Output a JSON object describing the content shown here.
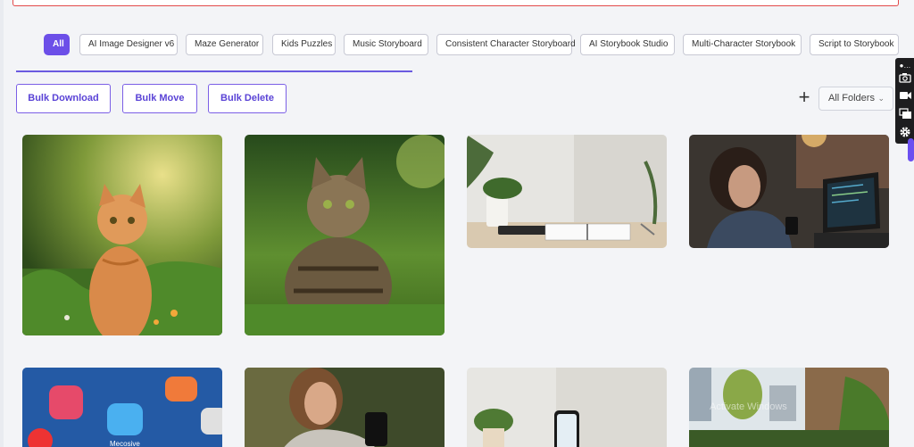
{
  "filters": [
    "All",
    "AI Image Designer v6",
    "Maze Generator",
    "Kids Puzzles",
    "Music Storyboard",
    "Consistent Character Storyboard",
    "AI Storybook Studio",
    "Multi-Character Storybook",
    "Script to Storybook"
  ],
  "actions": {
    "bulk_download": "Bulk Download",
    "bulk_move": "Bulk Move",
    "bulk_delete": "Bulk Delete",
    "add": "+",
    "folder_select": "All Folders"
  },
  "images": [
    {
      "name": "orange-kitten-in-grass"
    },
    {
      "name": "tabby-cat-in-grass"
    },
    {
      "name": "desk-with-notebook-and-plant"
    },
    {
      "name": "woman-with-phone-and-laptop"
    },
    {
      "name": "phone-app-icons"
    },
    {
      "name": "woman-looking-at-phone"
    },
    {
      "name": "phone-on-table-with-plant"
    },
    {
      "name": "balcony-garden-city"
    }
  ],
  "watermark": "Activate Windows",
  "colors": {
    "accent": "#6c4fe8",
    "alert_border": "#e24a4a"
  }
}
